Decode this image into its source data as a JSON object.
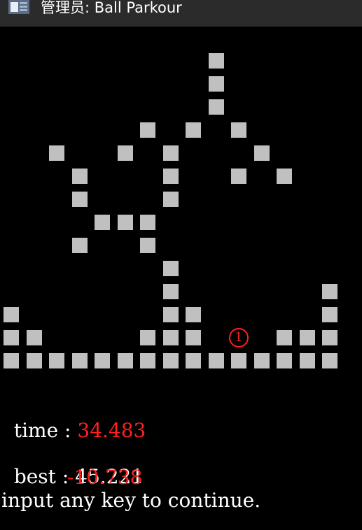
{
  "window": {
    "title": "管理员:  Ball Parkour",
    "icon": "console-app-icon"
  },
  "game": {
    "block_color": "#c0c0c0",
    "ball_symbol": "1",
    "ball_color": "#ff2020",
    "blocks": [
      [
        9,
        0
      ],
      [
        9,
        1
      ],
      [
        9,
        2
      ],
      [
        6,
        3
      ],
      [
        8,
        3
      ],
      [
        10,
        3
      ],
      [
        2,
        4
      ],
      [
        5,
        4
      ],
      [
        7,
        4
      ],
      [
        11,
        4
      ],
      [
        3,
        5
      ],
      [
        7,
        5
      ],
      [
        10,
        5
      ],
      [
        12,
        5
      ],
      [
        3,
        6
      ],
      [
        7,
        6
      ],
      [
        4,
        7
      ],
      [
        5,
        7
      ],
      [
        6,
        7
      ],
      [
        3,
        8
      ],
      [
        6,
        8
      ],
      [
        7,
        9
      ],
      [
        7,
        10
      ],
      [
        14,
        10
      ],
      [
        0,
        11
      ],
      [
        7,
        11
      ],
      [
        8,
        11
      ],
      [
        14,
        11
      ],
      [
        0,
        12
      ],
      [
        1,
        12
      ],
      [
        6,
        12
      ],
      [
        7,
        12
      ],
      [
        8,
        12
      ],
      [
        12,
        12
      ],
      [
        13,
        12
      ],
      [
        14,
        12
      ],
      [
        0,
        13
      ],
      [
        1,
        13
      ],
      [
        2,
        13
      ],
      [
        3,
        13
      ],
      [
        4,
        13
      ],
      [
        5,
        13
      ],
      [
        6,
        13
      ],
      [
        7,
        13
      ],
      [
        8,
        13
      ],
      [
        9,
        13
      ],
      [
        10,
        13
      ],
      [
        11,
        13
      ],
      [
        12,
        13
      ],
      [
        13,
        13
      ],
      [
        14,
        13
      ]
    ],
    "ball": [
      10,
      12
    ]
  },
  "stats": {
    "time_label": "time : ",
    "time_value": "34.483",
    "best_label": "best : ",
    "best_value": "45.221",
    "diff_value": "-10.738",
    "prompt": "input any key to continue."
  }
}
